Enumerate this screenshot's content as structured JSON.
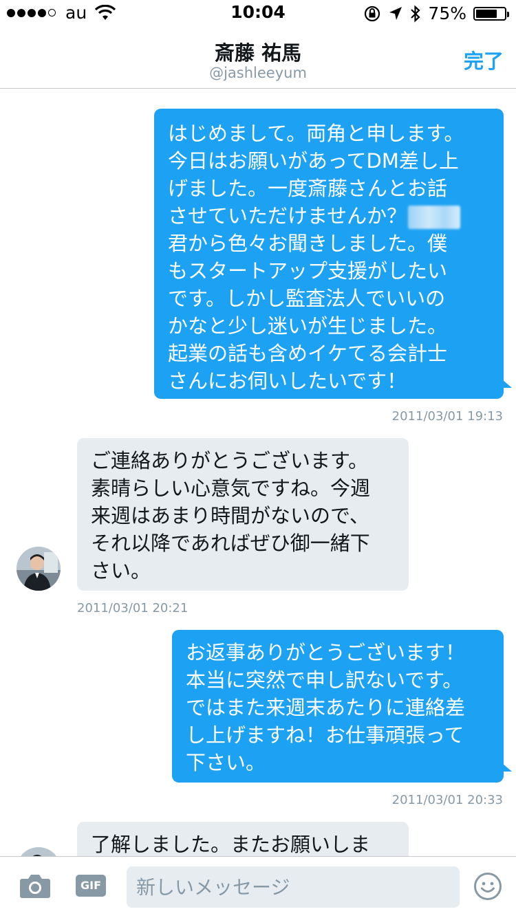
{
  "status_bar": {
    "carrier": "au",
    "time": "10:04",
    "battery_percent": "75%",
    "battery_level": 0.75,
    "signal_bars": 4
  },
  "header": {
    "name": "斎藤 祐馬",
    "handle": "@jashleeyum",
    "done_label": "完了"
  },
  "messages": [
    {
      "direction": "sent",
      "lines_before_blur": [
        "はじめまして。両角と申します。",
        "今日はお願いがあってDM差し上",
        "げました。一度斎藤さんとお話",
        "させていただけませんか？"
      ],
      "lines_after_blur": [
        "君から色々お聞きしました。僕",
        "もスタートアップ支援がしたい",
        "です。しかし監査法人でいいの",
        "かなと少し迷いが生じました。",
        "起業の話も含めイケてる会計士",
        "さんにお伺いしたいです！"
      ],
      "timestamp": "2011/03/01 19:13"
    },
    {
      "direction": "received",
      "lines": [
        "ご連絡ありがとうございます。",
        "素晴らしい心意気ですね。今週",
        "来週はあまり時間がないので、",
        "それ以降であればぜひ御一緒下",
        "さい。"
      ],
      "timestamp": "2011/03/01 20:21"
    },
    {
      "direction": "sent",
      "lines": [
        "お返事ありがとうございます！",
        "本当に突然で申し訳ないです。",
        "ではまた来週末あたりに連絡差",
        "し上げますね！お仕事頑張って",
        "下さい。"
      ],
      "timestamp": "2011/03/01 20:33"
    },
    {
      "direction": "received",
      "lines": [
        "了解しました。またお願いしま"
      ]
    }
  ],
  "compose": {
    "placeholder": "新しいメッセージ",
    "gif_label": "GIF",
    "icons": [
      "camera-icon",
      "gif-icon",
      "emoji-icon"
    ]
  },
  "colors": {
    "accent": "#1da1f2",
    "received_bubble": "#e6ecf0",
    "timestamp": "#8899a6"
  }
}
